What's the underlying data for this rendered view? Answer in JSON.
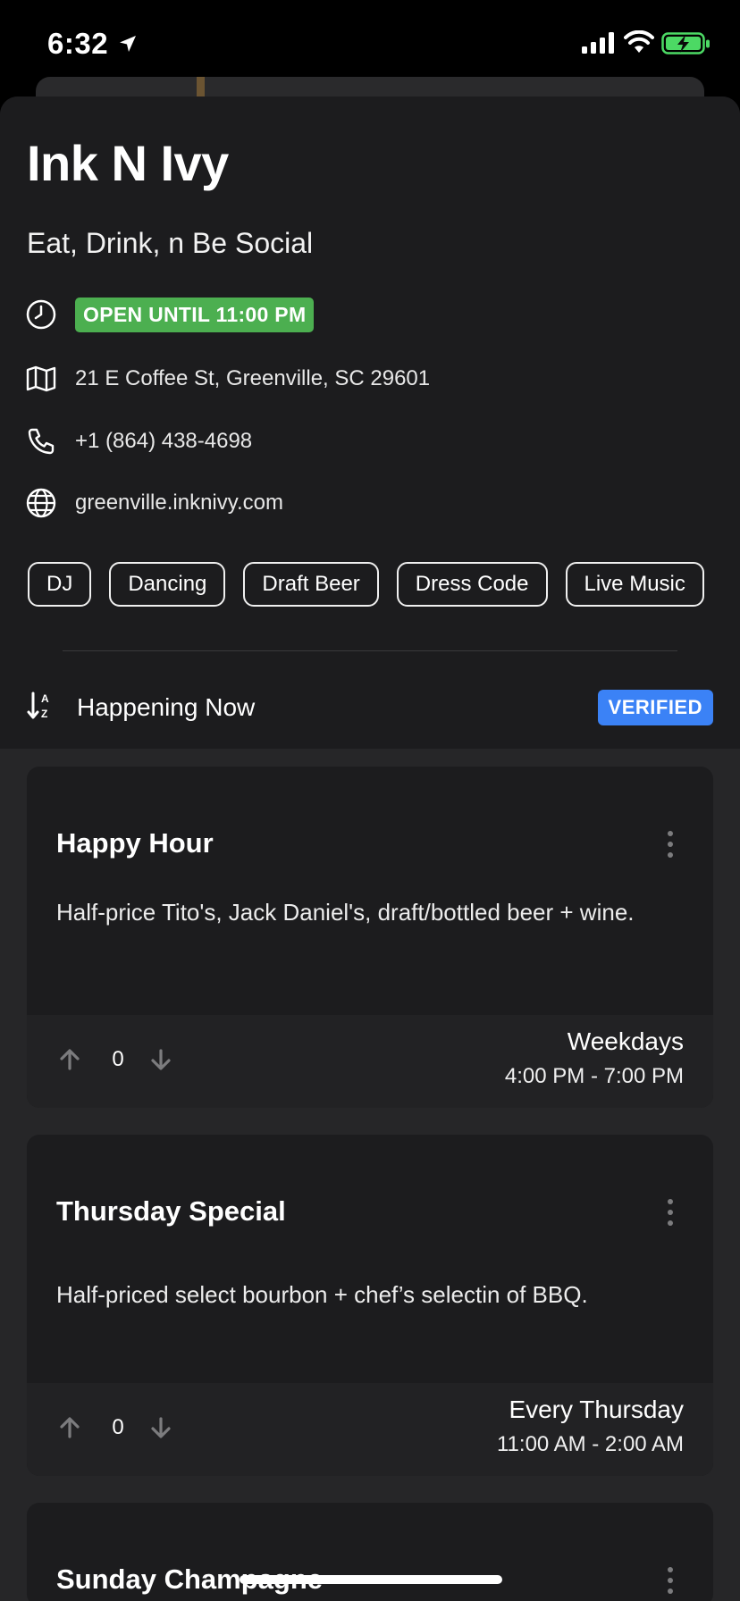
{
  "status_bar": {
    "time": "6:32"
  },
  "venue": {
    "name": "Ink N Ivy",
    "tagline": "Eat, Drink, n Be Social",
    "open_status": "OPEN UNTIL 11:00 PM",
    "address": "21 E Coffee St, Greenville, SC  29601",
    "phone": "+1 (864) 438-4698",
    "website": "greenville.inknivy.com"
  },
  "tags": [
    "DJ",
    "Dancing",
    "Draft Beer",
    "Dress Code",
    "Live Music"
  ],
  "section": {
    "label": "Happening Now",
    "badge": "VERIFIED"
  },
  "events": [
    {
      "title": "Happy Hour",
      "description": "Half-price Tito's, Jack Daniel's, draft/bottled beer + wine.",
      "votes": "0",
      "days": "Weekdays",
      "hours": "4:00 PM - 7:00 PM"
    },
    {
      "title": "Thursday Special",
      "description": "Half-priced select bourbon + chef’s selectin of BBQ.",
      "votes": "0",
      "days": "Every Thursday",
      "hours": "11:00 AM - 2:00 AM"
    },
    {
      "title": "Sunday Champagne"
    }
  ],
  "colors": {
    "background": "#1c1c1e",
    "open_badge": "#4caf50",
    "verified_badge": "#3b82f6"
  }
}
